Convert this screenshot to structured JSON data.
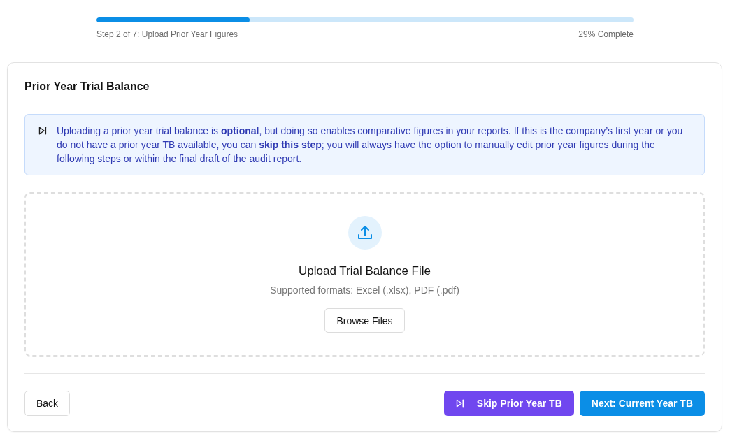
{
  "progress": {
    "level": 0.285,
    "step_label": "Step 2 of 7: Upload Prior Year Figures",
    "percent_label": "29% Complete"
  },
  "card": {
    "title": "Prior Year Trial Balance",
    "info_notice": {
      "text": "Uploading a prior year trial balance is **optional**, but doing so enables comparative figures in your reports. If this is the company’s first year or you do not have a prior year TB available, you can **skip this step**; you will always have the option to manually edit prior year figures during the following steps or within the final draft of the audit report."
    },
    "upload": {
      "title": "Upload Trial Balance File",
      "formats": "Supported formats: Excel (.xlsx), PDF (.pdf)",
      "button": "Browse Files"
    },
    "actions": [
      {
        "label": "Back",
        "kind": "secondary"
      },
      {
        "label": "Skip Prior Year TB",
        "kind": "skip"
      },
      {
        "label": "Next: Current Year TB",
        "kind": "primary"
      }
    ]
  }
}
